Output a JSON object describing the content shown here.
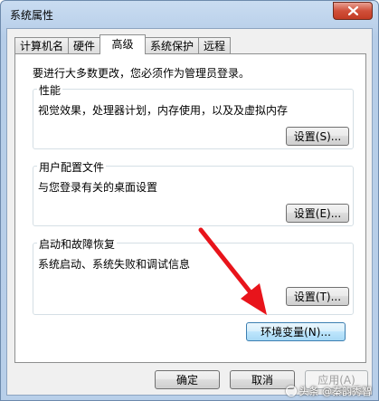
{
  "window": {
    "title": "系统属性"
  },
  "tabs": [
    {
      "label": "计算机名",
      "active": false
    },
    {
      "label": "硬件",
      "active": false
    },
    {
      "label": "高级",
      "active": true
    },
    {
      "label": "系统保护",
      "active": false
    },
    {
      "label": "远程",
      "active": false
    }
  ],
  "panel": {
    "notice": "要进行大多数更改，您必须作为管理员登录。",
    "performance": {
      "title": "性能",
      "description": "视觉效果，处理器计划，内存使用，以及及虚拟内存",
      "settings_label": "设置(S)..."
    },
    "user_profiles": {
      "title": "用户配置文件",
      "description": "与您登录有关的桌面设置",
      "settings_label": "设置(E)..."
    },
    "startup_recovery": {
      "title": "启动和故障恢复",
      "description": "系统启动、系统失败和调试信息",
      "settings_label": "设置(T)..."
    },
    "env_vars_label": "环境变量(N)..."
  },
  "footer": {
    "ok_label": "确定",
    "cancel_label": "取消",
    "apply_label": "应用(A)"
  },
  "watermark": "头条 @秦韵秀智",
  "colors": {
    "arrow": "#e8141b",
    "close_button": "#c94a34",
    "title_gradient": "#c9dcf1"
  }
}
